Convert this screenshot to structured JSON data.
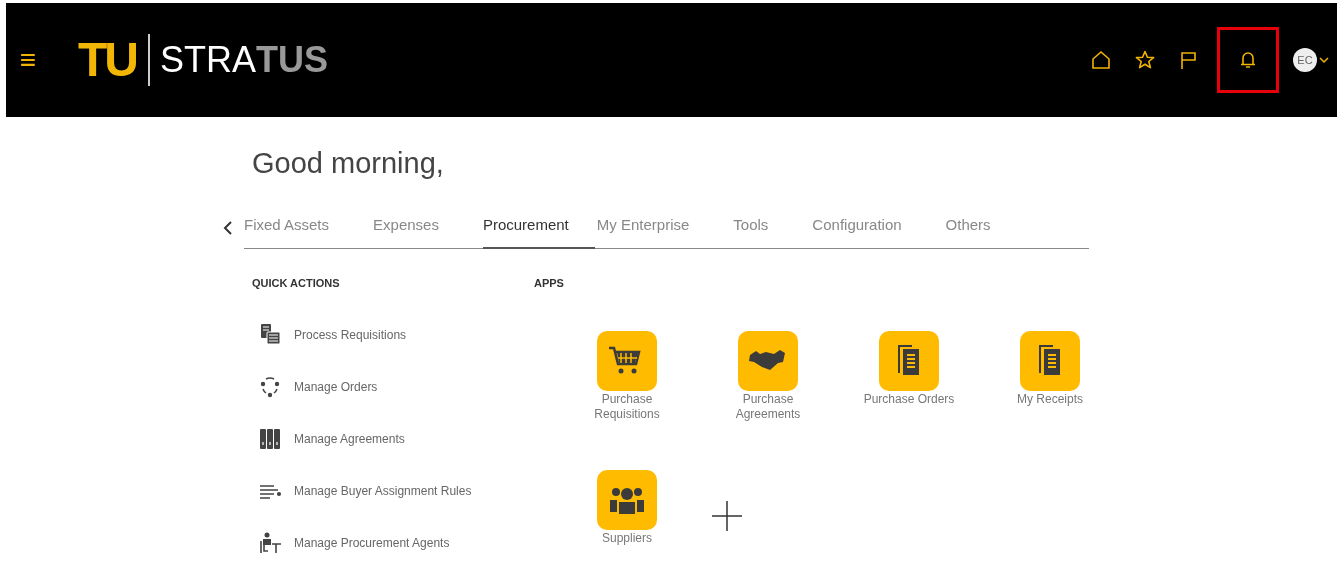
{
  "header": {
    "menu_icon": "≡",
    "logo": {
      "mark": "TU",
      "product": [
        {
          "text": "STRA",
          "kind": "plain"
        },
        {
          "text": "TUS",
          "kind": "accent"
        }
      ]
    },
    "actions": [
      {
        "kind": "home",
        "highlighted": false
      },
      {
        "kind": "favorite",
        "highlighted": false
      },
      {
        "kind": "flag",
        "highlighted": false
      },
      {
        "kind": "notifications",
        "highlighted": true
      }
    ],
    "user": {
      "initials": "EC"
    }
  },
  "greeting": "Good morning,",
  "tabs": [
    {
      "label": "Fixed Assets",
      "selected": false
    },
    {
      "label": "Expenses",
      "selected": false
    },
    {
      "label": "Procurement",
      "selected": true
    },
    {
      "label": "My Enterprise",
      "selected": false
    },
    {
      "label": "Tools",
      "selected": false
    },
    {
      "label": "Configuration",
      "selected": false
    },
    {
      "label": "Others",
      "selected": false
    }
  ],
  "quick_actions": {
    "title": "QUICK ACTIONS",
    "items": [
      {
        "label": "Process Requisitions",
        "kind": "requisitions"
      },
      {
        "label": "Manage Orders",
        "kind": "orders"
      },
      {
        "label": "Manage Agreements",
        "kind": "agreements"
      },
      {
        "label": "Manage Buyer Assignment Rules",
        "kind": "rules"
      },
      {
        "label": "Manage Procurement Agents",
        "kind": "agents"
      }
    ]
  },
  "apps": {
    "title": "APPS",
    "items": [
      {
        "label": "Purchase Requisitions",
        "kind": "cart"
      },
      {
        "label": "Purchase Agreements",
        "kind": "handshake"
      },
      {
        "label": "Purchase Orders",
        "kind": "document"
      },
      {
        "label": "My Receipts",
        "kind": "document"
      },
      {
        "label": "Suppliers",
        "kind": "people"
      }
    ]
  }
}
